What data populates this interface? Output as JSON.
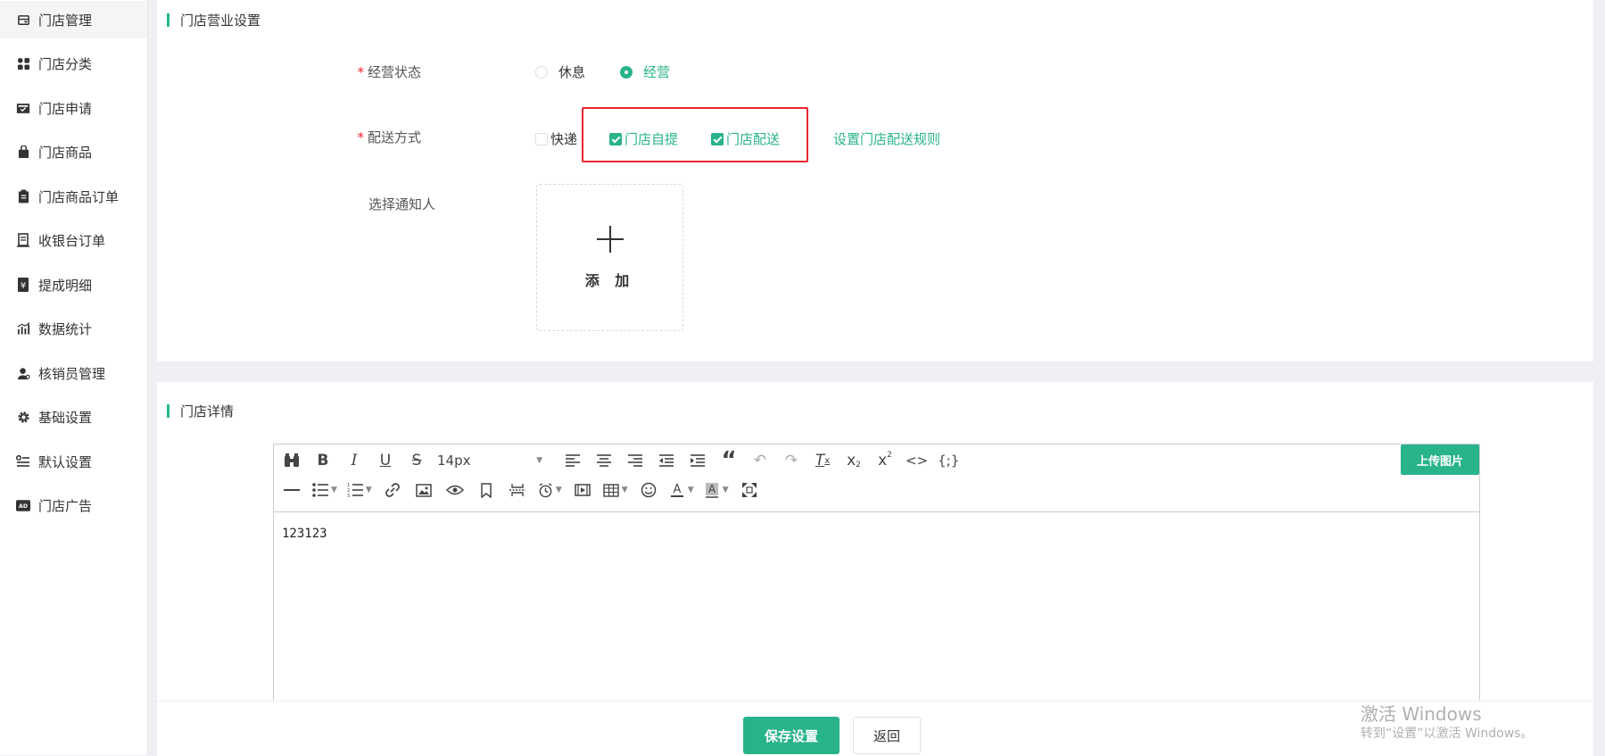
{
  "sidebar": {
    "items": [
      {
        "label": "门店管理",
        "icon": "store-manage-icon",
        "active": true
      },
      {
        "label": "门店分类",
        "icon": "category-grid-icon"
      },
      {
        "label": "门店申请",
        "icon": "application-inbox-icon"
      },
      {
        "label": "门店商品",
        "icon": "shopping-bag-icon"
      },
      {
        "label": "门店商品订单",
        "icon": "clipboard-order-icon"
      },
      {
        "label": "收银台订单",
        "icon": "receipt-icon"
      },
      {
        "label": "提成明细",
        "icon": "yuan-commission-icon"
      },
      {
        "label": "数据统计",
        "icon": "bar-chart-icon"
      },
      {
        "label": "核销员管理",
        "icon": "user-manage-icon"
      },
      {
        "label": "基础设置",
        "icon": "gear-icon"
      },
      {
        "label": "默认设置",
        "icon": "list-settings-icon"
      },
      {
        "label": "门店广告",
        "icon": "ad-icon"
      }
    ]
  },
  "business": {
    "section_title": "门店营业设置",
    "status_label": "经营状态",
    "status_options": [
      "休息",
      "经营"
    ],
    "status_selected": "经营",
    "delivery_label": "配送方式",
    "delivery_options": [
      {
        "label": "快递",
        "checked": false
      },
      {
        "label": "门店自提",
        "checked": true
      },
      {
        "label": "门店配送",
        "checked": true
      }
    ],
    "delivery_rule_link": "设置门店配送规则",
    "notifier_label": "选择通知人",
    "add_text": "添 加"
  },
  "details": {
    "section_title": "门店详情",
    "font_size": "14px",
    "upload_label": "上传图片",
    "content": "123123"
  },
  "footer": {
    "save_label": "保存设置",
    "back_label": "返回"
  },
  "watermark": {
    "line1": "激活 Windows",
    "line2": "转到“设置”以激活 Windows。"
  },
  "colors": {
    "accent": "#29b38b",
    "highlight": "#e8262c"
  }
}
